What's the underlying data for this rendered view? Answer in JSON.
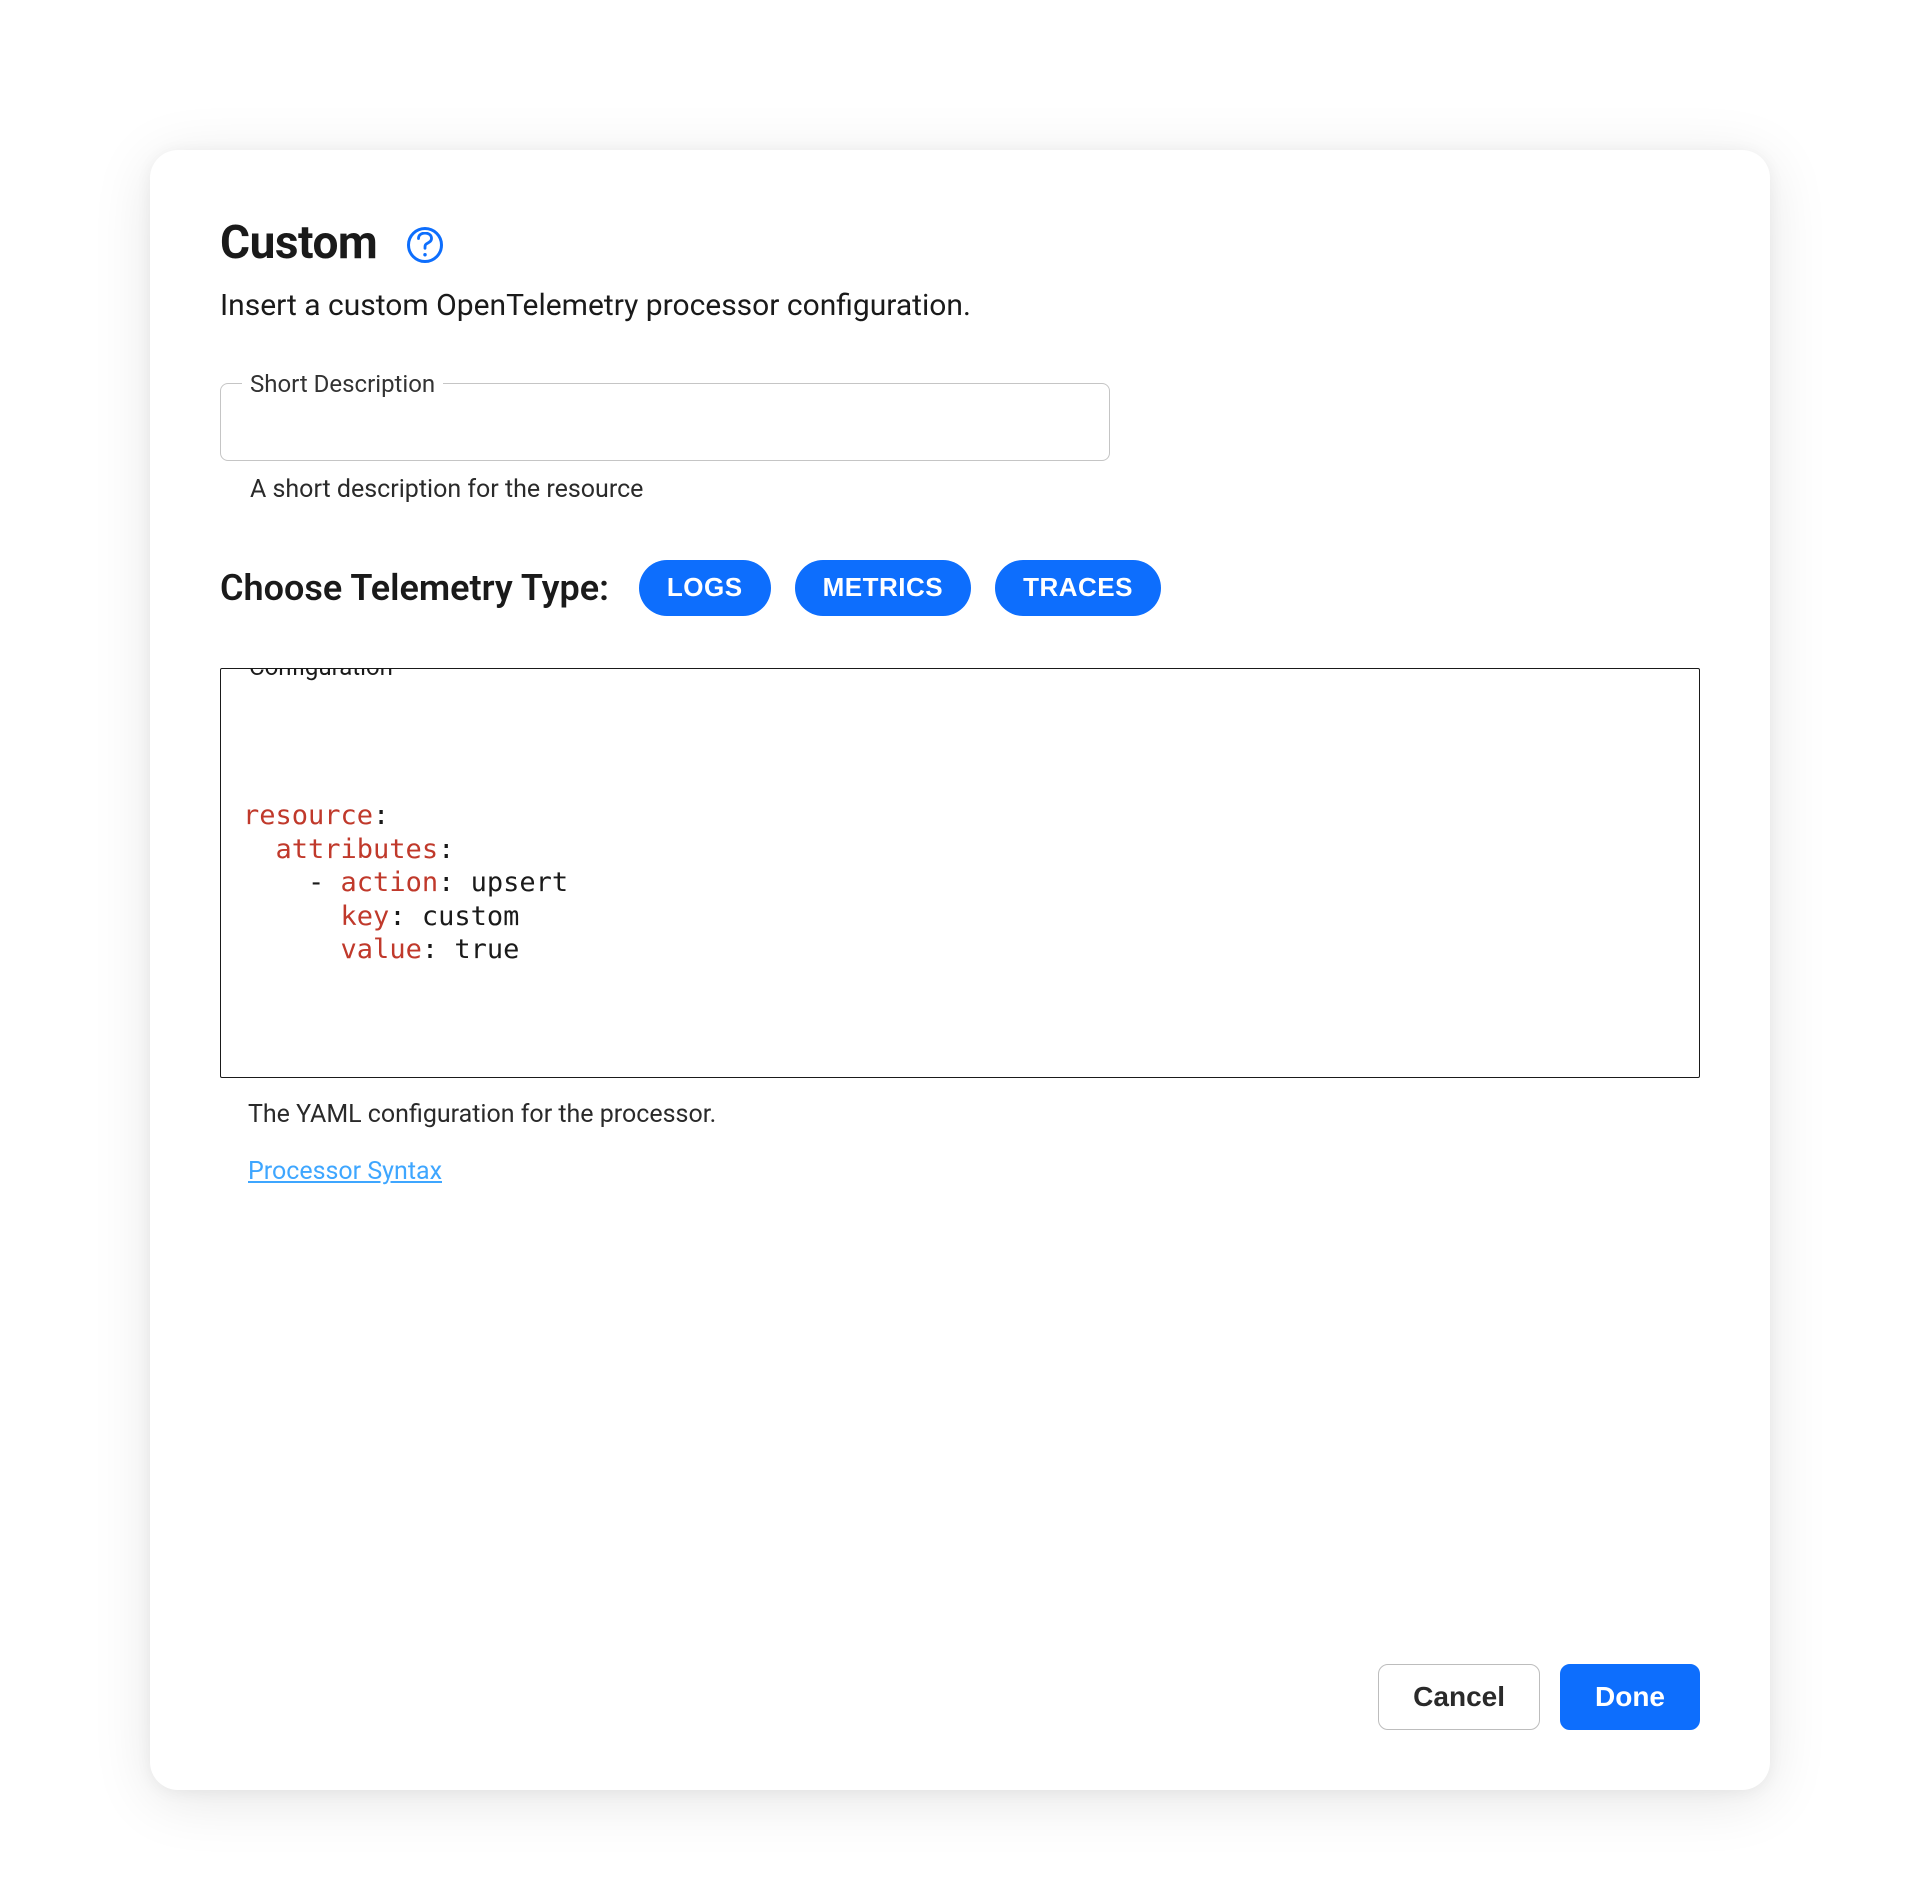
{
  "header": {
    "title": "Custom",
    "subtitle": "Insert a custom OpenTelemetry processor configuration."
  },
  "shortDescription": {
    "label": "Short Description",
    "value": "",
    "helper": "A short description for the resource"
  },
  "telemetry": {
    "label": "Choose Telemetry Type:",
    "options": [
      "LOGS",
      "METRICS",
      "TRACES"
    ]
  },
  "configuration": {
    "label": "Configuration *",
    "helper": "The YAML configuration for the processor.",
    "syntaxLinkLabel": "Processor Syntax",
    "yaml": [
      {
        "indent": 0,
        "dash": false,
        "key": "resource",
        "value": ""
      },
      {
        "indent": 1,
        "dash": false,
        "key": "attributes",
        "value": ""
      },
      {
        "indent": 2,
        "dash": true,
        "key": "action",
        "value": "upsert"
      },
      {
        "indent": 3,
        "dash": false,
        "key": "key",
        "value": "custom"
      },
      {
        "indent": 3,
        "dash": false,
        "key": "value",
        "value": "true"
      }
    ]
  },
  "footer": {
    "cancel": "Cancel",
    "done": "Done"
  }
}
